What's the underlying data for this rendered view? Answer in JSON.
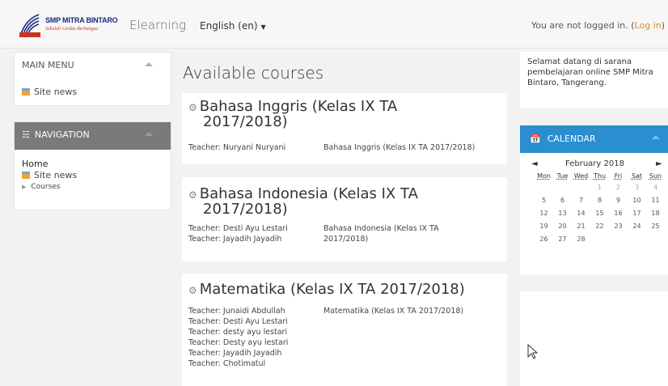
{
  "header": {
    "logo": {
      "title": "SMP MITRA BINTARO",
      "motto": "Sekolah Cerdas Berbangsa",
      "emblem_label": "MITRA"
    },
    "brand": "Elearning",
    "language": "English (en)",
    "login_text": "You are not logged in. (",
    "login_link": "Log in",
    "login_close": ")"
  },
  "main_menu": {
    "title": "MAIN MENU",
    "items": [
      {
        "label": "Site news",
        "icon": "news-icon"
      }
    ]
  },
  "navigation": {
    "title": "NAVIGATION",
    "home": "Home",
    "site_news": "Site news",
    "courses": "Courses"
  },
  "page": {
    "heading": "Available courses"
  },
  "courses": [
    {
      "title_l1": "Bahasa Inggris (Kelas IX TA",
      "title_l2": "2017/2018)",
      "teachers": [
        "Teacher: Nuryani Nuryani"
      ],
      "summary": "Bahasa Inggris (Kelas IX TA 2017/2018)"
    },
    {
      "title_l1": "Bahasa Indonesia (Kelas IX TA",
      "title_l2": "2017/2018)",
      "teachers": [
        "Teacher: Desti Ayu Lestari",
        "Teacher: Jayadih Jayadih"
      ],
      "summary": "Bahasa Indonesia (Kelas IX TA 2017/2018)"
    },
    {
      "title_l1": "Matematika (Kelas IX TA 2017/2018)",
      "teachers": [
        "Teacher: Junaidi Abdullah",
        "Teacher: Desti Ayu Lestari",
        "Teacher: desty ayu lestari",
        "Teacher: Desty ayu lestari",
        "Teacher: Jayadih Jayadih",
        "Teacher: Chotimatul"
      ],
      "summary": "Matematika (Kelas IX TA 2017/2018)"
    }
  ],
  "welcome": "Selamat datang di sarana pembelajaran online SMP Mitra Bintaro, Tangerang.",
  "calendar": {
    "title": "CALENDAR",
    "month": "February 2018",
    "prev": "◄",
    "next": "►",
    "weekdays": [
      "Mon",
      "Tue",
      "Wed",
      "Thu",
      "Fri",
      "Sat",
      "Sun"
    ],
    "weeks": [
      [
        "",
        "",
        "",
        "1",
        "2",
        "3",
        "4"
      ],
      [
        "5",
        "6",
        "7",
        "8",
        "9",
        "10",
        "11"
      ],
      [
        "12",
        "13",
        "14",
        "15",
        "16",
        "17",
        "18"
      ],
      [
        "19",
        "20",
        "21",
        "22",
        "23",
        "24",
        "25"
      ],
      [
        "26",
        "27",
        "28",
        "",
        "",
        "",
        ""
      ]
    ]
  },
  "colors": {
    "accent": "#2a8ed0",
    "login_link": "#e8851e",
    "nav_header": "#7a7a7a"
  }
}
